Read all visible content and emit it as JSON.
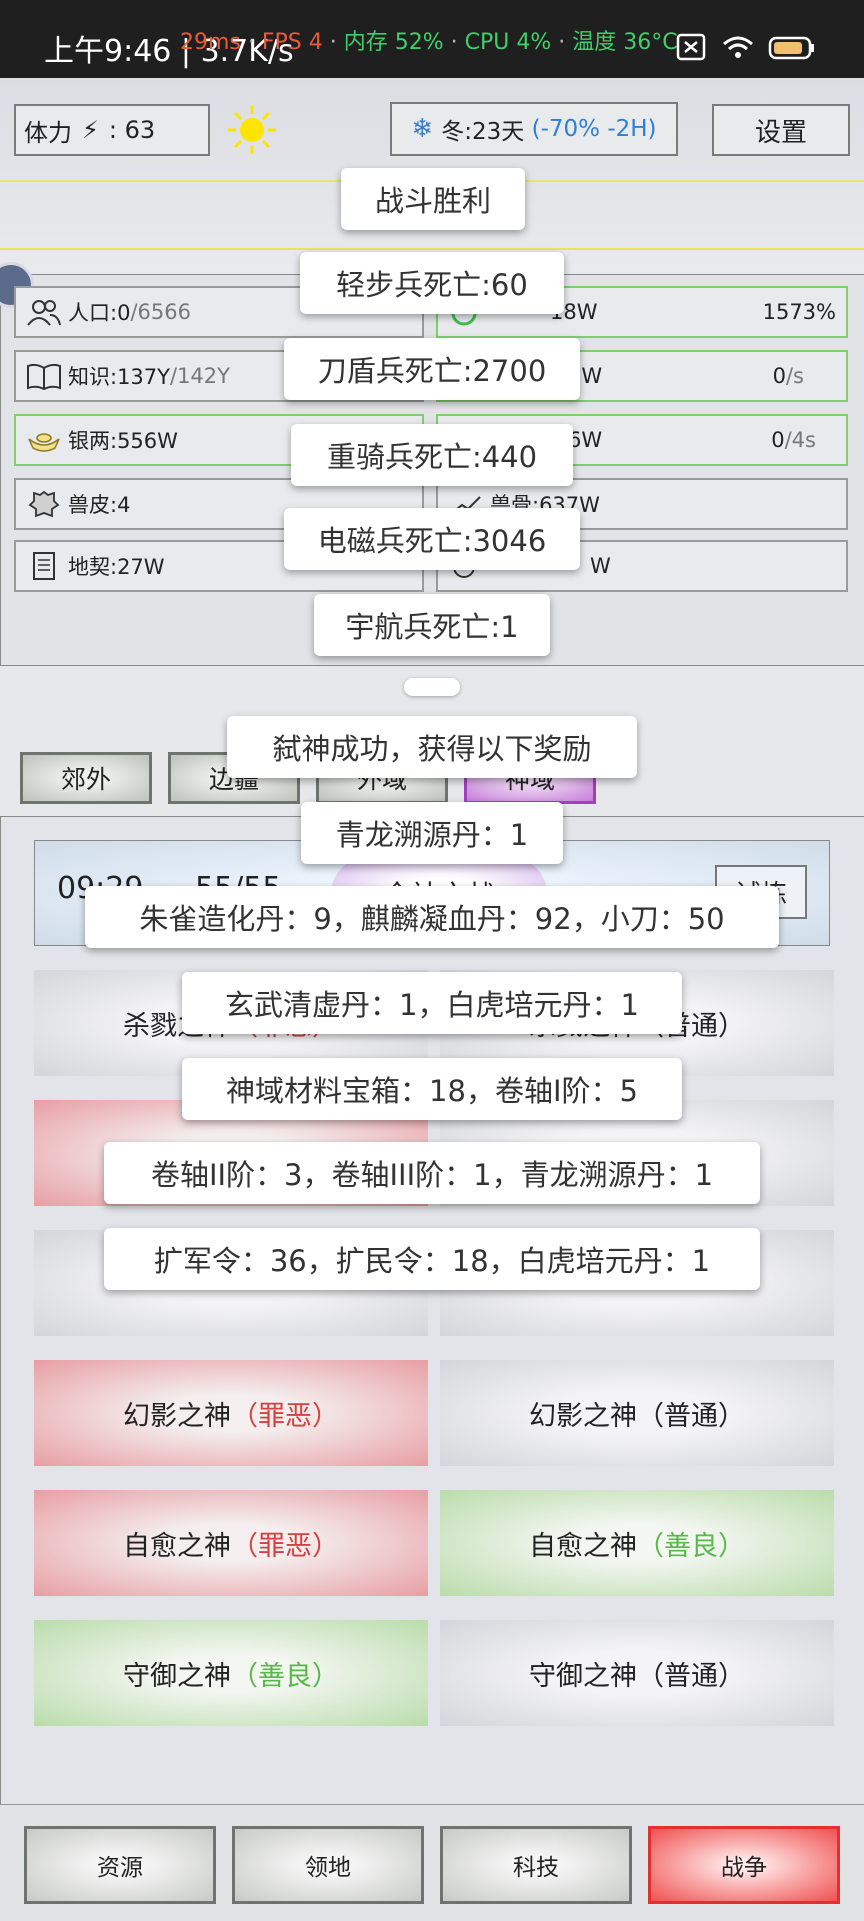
{
  "status_bar": {
    "time": "上午9:46",
    "speed": "3.7K/s",
    "ping": "29ms",
    "fps": "FPS 4",
    "memory": "内存 52%",
    "cpu": "CPU 4%",
    "temp": "温度 36°C"
  },
  "top": {
    "stamina_label": "体力",
    "stamina_value": "63",
    "season": "冬:23天",
    "season_effect": "(-70% -2H)",
    "settings_label": "设置"
  },
  "resources": {
    "population": "人口:0",
    "population_cap": "/6566",
    "knowledge": "知识:137Y",
    "knowledge_cap": "/142Y",
    "silver": "银两:556W",
    "hide": "兽皮:4",
    "deed": "地契:27W",
    "right_1_value": "18W",
    "right_1_rate": "1573%",
    "right_2_value": "6W",
    "right_2_rate": "0",
    "right_2_unit": "/s",
    "right_3_value": "6W",
    "right_3_rate": "0",
    "right_3_unit": "/4s",
    "bone": "兽骨:637W",
    "right_5_value": "W"
  },
  "tabs": {
    "outskirts": "郊外",
    "frontier": "边疆",
    "tab3": "外域",
    "god_domain": "神域"
  },
  "battle": {
    "timer": "09:29",
    "count": "55/55",
    "title": "全神之战",
    "trial": "试炼"
  },
  "gods": [
    {
      "name": "杀戮之神",
      "tag": "（罪恶）",
      "tag_type": "red",
      "right_name": "杀戮之神",
      "right_tag": "（普通）",
      "right_type": "normal"
    },
    {
      "name": "幻影之神",
      "tag": "（罪恶）",
      "tag_type": "red",
      "right_name": "幻影之神",
      "right_tag": "（普通）",
      "right_type": "normal"
    },
    {
      "name": "自愈之神",
      "tag": "（罪恶）",
      "tag_type": "red",
      "right_name": "自愈之神",
      "right_tag": "（善良）",
      "right_type": "green"
    },
    {
      "name": "守御之神",
      "tag": "（善良）",
      "tag_type": "green",
      "right_name": "守御之神",
      "right_tag": "（普通）",
      "right_type": "normal"
    }
  ],
  "toasts": {
    "victory": "战斗胜利",
    "light_infantry": "轻步兵死亡:60",
    "shield_infantry": "刀盾兵死亡:2700",
    "heavy_cavalry": "重骑兵死亡:440",
    "em_soldier": "电磁兵死亡:3046",
    "space_soldier": "宇航兵死亡:1",
    "god_slain": "弑神成功，获得以下奖励",
    "reward_1": "青龙溯源丹：1",
    "reward_2": "朱雀造化丹：9，麒麟凝血丹：92，小刀：50",
    "reward_3": "玄武清虚丹：1，白虎培元丹：1",
    "reward_4": "神域材料宝箱：18，卷轴I阶：5",
    "reward_5": "卷轴II阶：3，卷轴III阶：1，青龙溯源丹：1",
    "reward_6": "扩军令：36，扩民令：18，白虎培元丹：1"
  },
  "bottom_nav": {
    "resources": "资源",
    "territory": "领地",
    "tech": "科技",
    "war": "战争"
  }
}
